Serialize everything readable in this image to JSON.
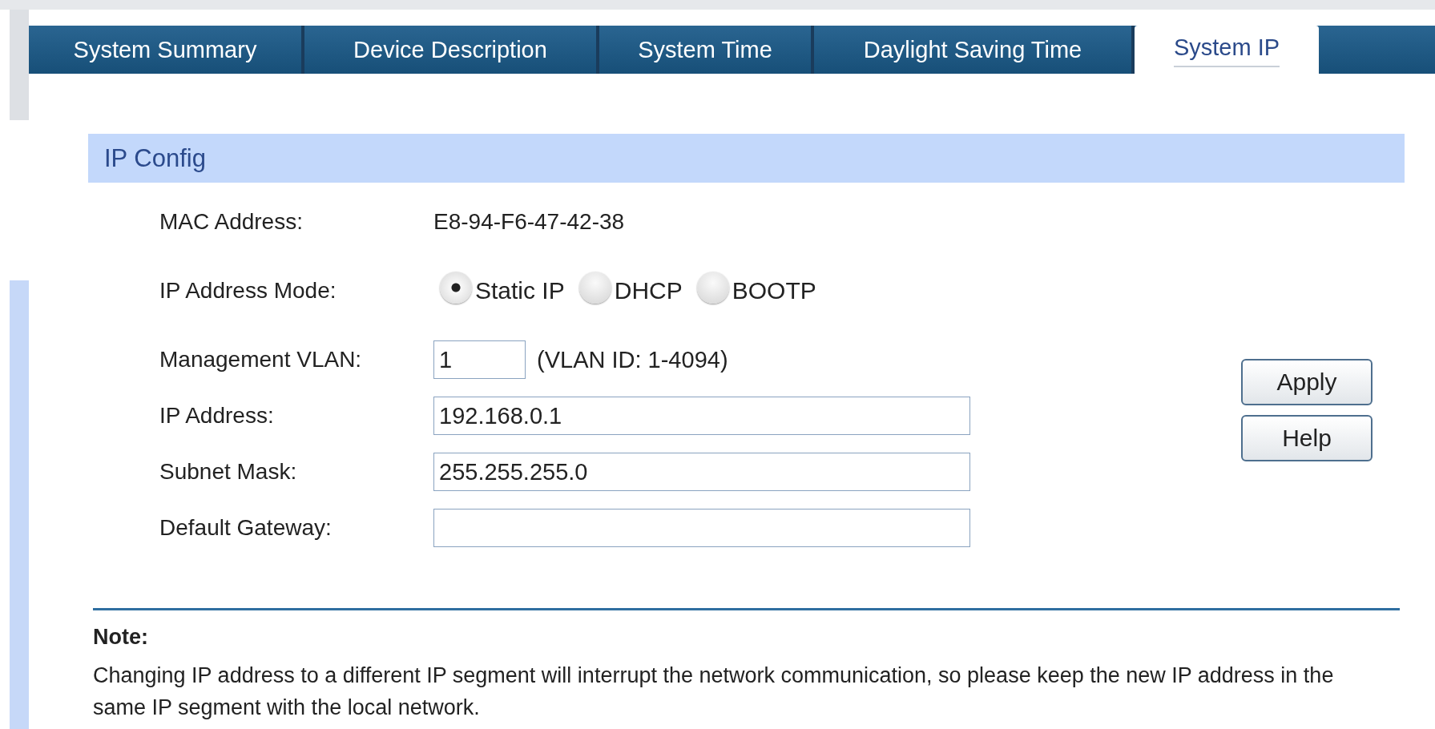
{
  "tabs": [
    {
      "label": "System Summary",
      "selected": false
    },
    {
      "label": "Device Description",
      "selected": false
    },
    {
      "label": "System Time",
      "selected": false
    },
    {
      "label": "Daylight Saving Time",
      "selected": false
    },
    {
      "label": "System IP",
      "selected": true
    }
  ],
  "section": {
    "title": "IP Config"
  },
  "fields": [
    {
      "kind": "text",
      "label": "MAC Address:",
      "value": "E8-94-F6-47-42-38"
    },
    {
      "kind": "radio",
      "label": "IP Address Mode:",
      "options": [
        {
          "label": "Static IP",
          "selected": true
        },
        {
          "label": "DHCP",
          "selected": false
        },
        {
          "label": "BOOTP",
          "selected": false
        }
      ]
    },
    {
      "kind": "short-input",
      "label": "Management VLAN:",
      "value": "1",
      "hint": "(VLAN ID: 1-4094)"
    },
    {
      "kind": "input",
      "label": "IP Address:",
      "value": "192.168.0.1"
    },
    {
      "kind": "input",
      "label": "Subnet Mask:",
      "value": "255.255.255.0"
    },
    {
      "kind": "input",
      "label": "Default Gateway:"
    }
  ],
  "buttons": [
    "Apply",
    "Help"
  ],
  "note": {
    "title": "Note:",
    "text": "Changing IP address to a different IP segment will interrupt the network communication, so please keep the new IP address in the same IP segment with the local network."
  }
}
